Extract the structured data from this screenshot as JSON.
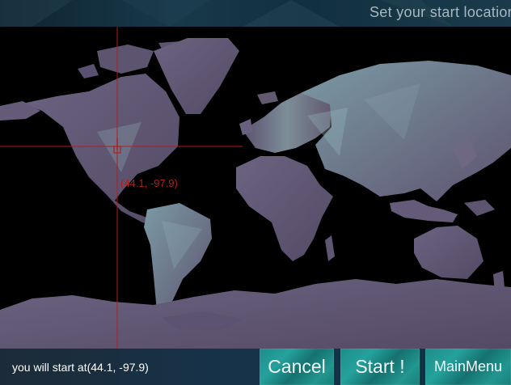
{
  "header": {
    "title": "Set your start location"
  },
  "map": {
    "marker_label": "(44.1, -97.9)",
    "marker_lat": 44.1,
    "marker_lon": -97.9
  },
  "footer": {
    "status_text": "you will start at(44.1, -97.9)",
    "cancel_label": "Cancel",
    "start_label": "Start !",
    "menu_label": "MainMenu"
  },
  "colors": {
    "land": "#6e6480",
    "marker": "#b11d1d",
    "button": "#1d8d89",
    "bar": "#17394a"
  }
}
